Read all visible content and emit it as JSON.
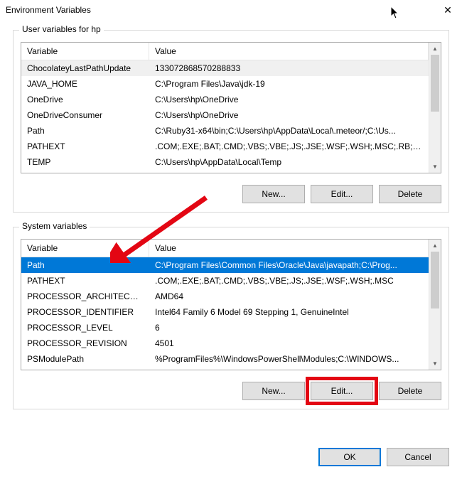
{
  "title": "Environment Variables",
  "closeGlyph": "✕",
  "userGroup": {
    "label": "User variables for hp",
    "columns": {
      "var": "Variable",
      "val": "Value"
    },
    "rows": [
      {
        "var": "ChocolateyLastPathUpdate",
        "val": "133072868570288833",
        "selected": "grey"
      },
      {
        "var": "JAVA_HOME",
        "val": "C:\\Program Files\\Java\\jdk-19"
      },
      {
        "var": "OneDrive",
        "val": "C:\\Users\\hp\\OneDrive"
      },
      {
        "var": "OneDriveConsumer",
        "val": "C:\\Users\\hp\\OneDrive"
      },
      {
        "var": "Path",
        "val": "C:\\Ruby31-x64\\bin;C:\\Users\\hp\\AppData\\Local\\.meteor/;C:\\Us..."
      },
      {
        "var": "PATHEXT",
        "val": ".COM;.EXE;.BAT;.CMD;.VBS;.VBE;.JS;.JSE;.WSF;.WSH;.MSC;.RB;.RB..."
      },
      {
        "var": "TEMP",
        "val": "C:\\Users\\hp\\AppData\\Local\\Temp"
      }
    ],
    "buttons": {
      "new": "New...",
      "edit": "Edit...",
      "delete": "Delete"
    }
  },
  "systemGroup": {
    "label": "System variables",
    "columns": {
      "var": "Variable",
      "val": "Value"
    },
    "rows": [
      {
        "var": "Path",
        "val": "C:\\Program Files\\Common Files\\Oracle\\Java\\javapath;C:\\Prog...",
        "selected": "blue"
      },
      {
        "var": "PATHEXT",
        "val": ".COM;.EXE;.BAT;.CMD;.VBS;.VBE;.JS;.JSE;.WSF;.WSH;.MSC"
      },
      {
        "var": "PROCESSOR_ARCHITECTU...",
        "val": "AMD64"
      },
      {
        "var": "PROCESSOR_IDENTIFIER",
        "val": "Intel64 Family 6 Model 69 Stepping 1, GenuineIntel"
      },
      {
        "var": "PROCESSOR_LEVEL",
        "val": "6"
      },
      {
        "var": "PROCESSOR_REVISION",
        "val": "4501"
      },
      {
        "var": "PSModulePath",
        "val": "%ProgramFiles%\\WindowsPowerShell\\Modules;C:\\WINDOWS..."
      }
    ],
    "buttons": {
      "new": "New...",
      "edit": "Edit...",
      "delete": "Delete"
    }
  },
  "footer": {
    "ok": "OK",
    "cancel": "Cancel"
  },
  "scrollArrows": {
    "up": "▲",
    "down": "▼"
  }
}
